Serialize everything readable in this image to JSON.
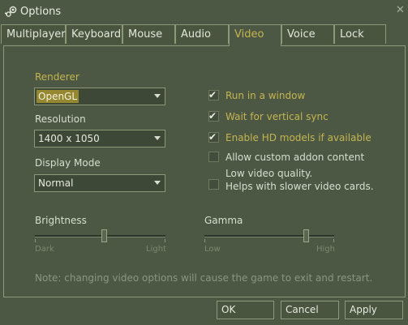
{
  "window": {
    "title": "Options",
    "close_glyph": "✕"
  },
  "tabs": [
    {
      "label": "Multiplayer"
    },
    {
      "label": "Keyboard"
    },
    {
      "label": "Mouse"
    },
    {
      "label": "Audio"
    },
    {
      "label": "Video",
      "active": true
    },
    {
      "label": "Voice"
    },
    {
      "label": "Lock"
    }
  ],
  "video": {
    "renderer": {
      "label": "Renderer",
      "value": "OpenGL"
    },
    "resolution": {
      "label": "Resolution",
      "value": "1400 x 1050"
    },
    "display_mode": {
      "label": "Display Mode",
      "value": "Normal"
    },
    "checkboxes": [
      {
        "label": "Run in a window",
        "checked": true
      },
      {
        "label": "Wait for vertical sync",
        "checked": true
      },
      {
        "label": "Enable HD models if available",
        "checked": true
      },
      {
        "label": "Allow custom addon content",
        "checked": false
      },
      {
        "label": "Low video quality.",
        "label2": "Helps with slower video cards.",
        "checked": false
      }
    ],
    "check_glyph": "✔",
    "brightness": {
      "label": "Brightness",
      "min_label": "Dark",
      "max_label": "Light",
      "value": 0.53
    },
    "gamma": {
      "label": "Gamma",
      "min_label": "Low",
      "max_label": "High",
      "value": 0.78
    },
    "note": "Note: changing video options will cause the game to exit and restart."
  },
  "buttons": {
    "ok": "OK",
    "cancel": "Cancel",
    "apply": "Apply"
  },
  "colors": {
    "accent": "#c4b550",
    "background": "#4c5844",
    "selection": "#958830"
  }
}
